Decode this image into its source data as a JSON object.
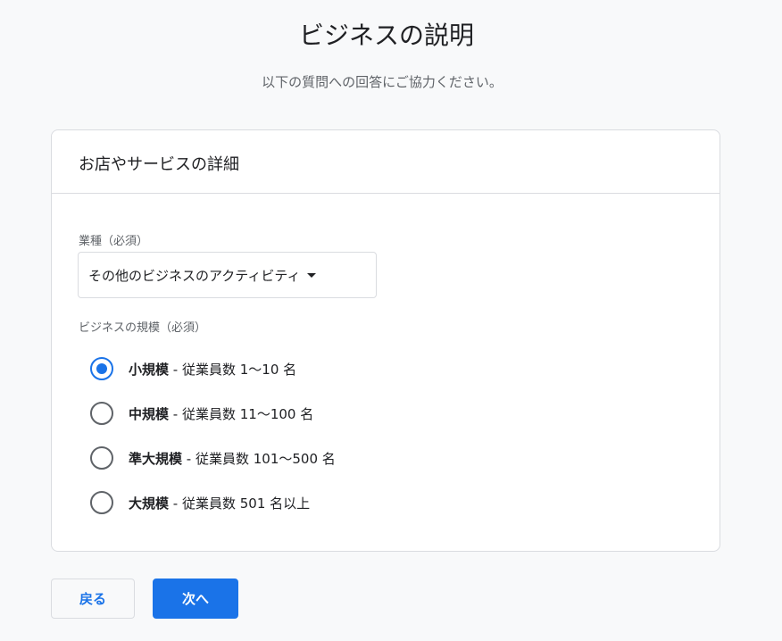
{
  "page": {
    "title": "ビジネスの説明",
    "subtitle": "以下の質問への回答にご協力ください。"
  },
  "card": {
    "header": "お店やサービスの詳細",
    "industry": {
      "label": "業種（必須）",
      "value": "その他のビジネスのアクティビティ"
    },
    "size": {
      "label": "ビジネスの規模（必須）",
      "options": [
        {
          "name": "小規模",
          "detail": " - 従業員数 1〜10 名",
          "checked": true
        },
        {
          "name": "中規模",
          "detail": " - 従業員数 11〜100 名",
          "checked": false
        },
        {
          "name": "準大規模",
          "detail": " - 従業員数 101〜500 名",
          "checked": false
        },
        {
          "name": "大規模",
          "detail": " - 従業員数 501 名以上",
          "checked": false
        }
      ]
    }
  },
  "buttons": {
    "back": "戻る",
    "next": "次へ"
  },
  "colors": {
    "accent": "#1a73e8",
    "background": "#f8f9fa",
    "border": "#dadce0"
  }
}
